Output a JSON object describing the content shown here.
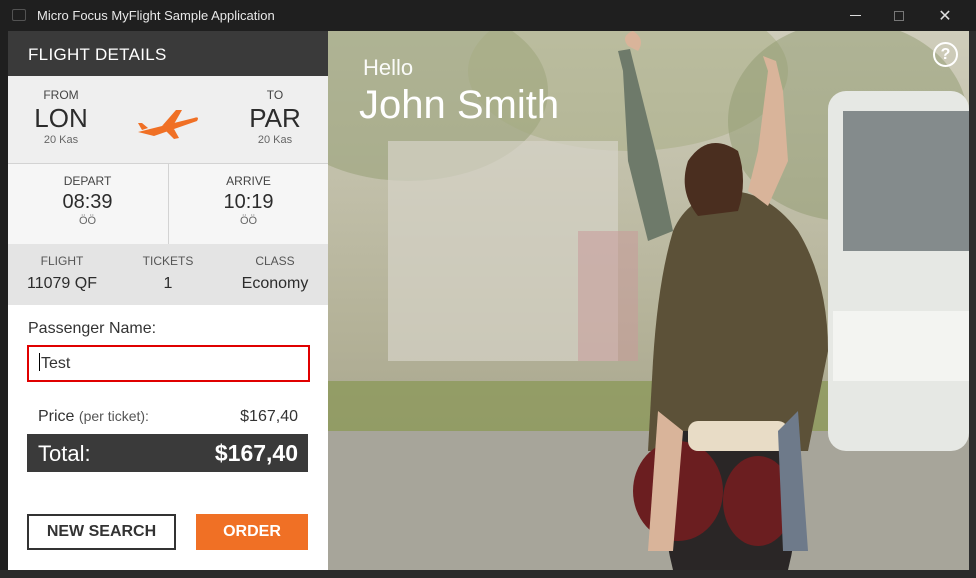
{
  "window": {
    "title": "Micro Focus MyFlight Sample Application"
  },
  "panel": {
    "header": "FLIGHT DETAILS",
    "from": {
      "label": "FROM",
      "code": "LON",
      "date": "20 Kas"
    },
    "to": {
      "label": "TO",
      "code": "PAR",
      "date": "20 Kas"
    },
    "depart": {
      "label": "DEPART",
      "time": "08:39",
      "suffix": "ÖÖ"
    },
    "arrive": {
      "label": "ARRIVE",
      "time": "10:19",
      "suffix": "ÖÖ"
    },
    "flight": {
      "label": "FLIGHT",
      "value": "11079 QF"
    },
    "tickets": {
      "label": "TICKETS",
      "value": "1"
    },
    "class": {
      "label": "CLASS",
      "value": "Economy"
    },
    "passenger": {
      "label": "Passenger Name:",
      "value": "Test"
    },
    "price": {
      "label": "Price",
      "sub": "(per ticket):",
      "value": "$167,40"
    },
    "total": {
      "label": "Total:",
      "value": "$167,40"
    },
    "buttons": {
      "new_search": "NEW SEARCH",
      "order": "ORDER"
    }
  },
  "hero": {
    "greeting": "Hello",
    "user_name": "John Smith",
    "help": "?"
  },
  "colors": {
    "accent": "#f07025",
    "header_dark": "#3a3a3a",
    "input_border": "#e00000"
  }
}
